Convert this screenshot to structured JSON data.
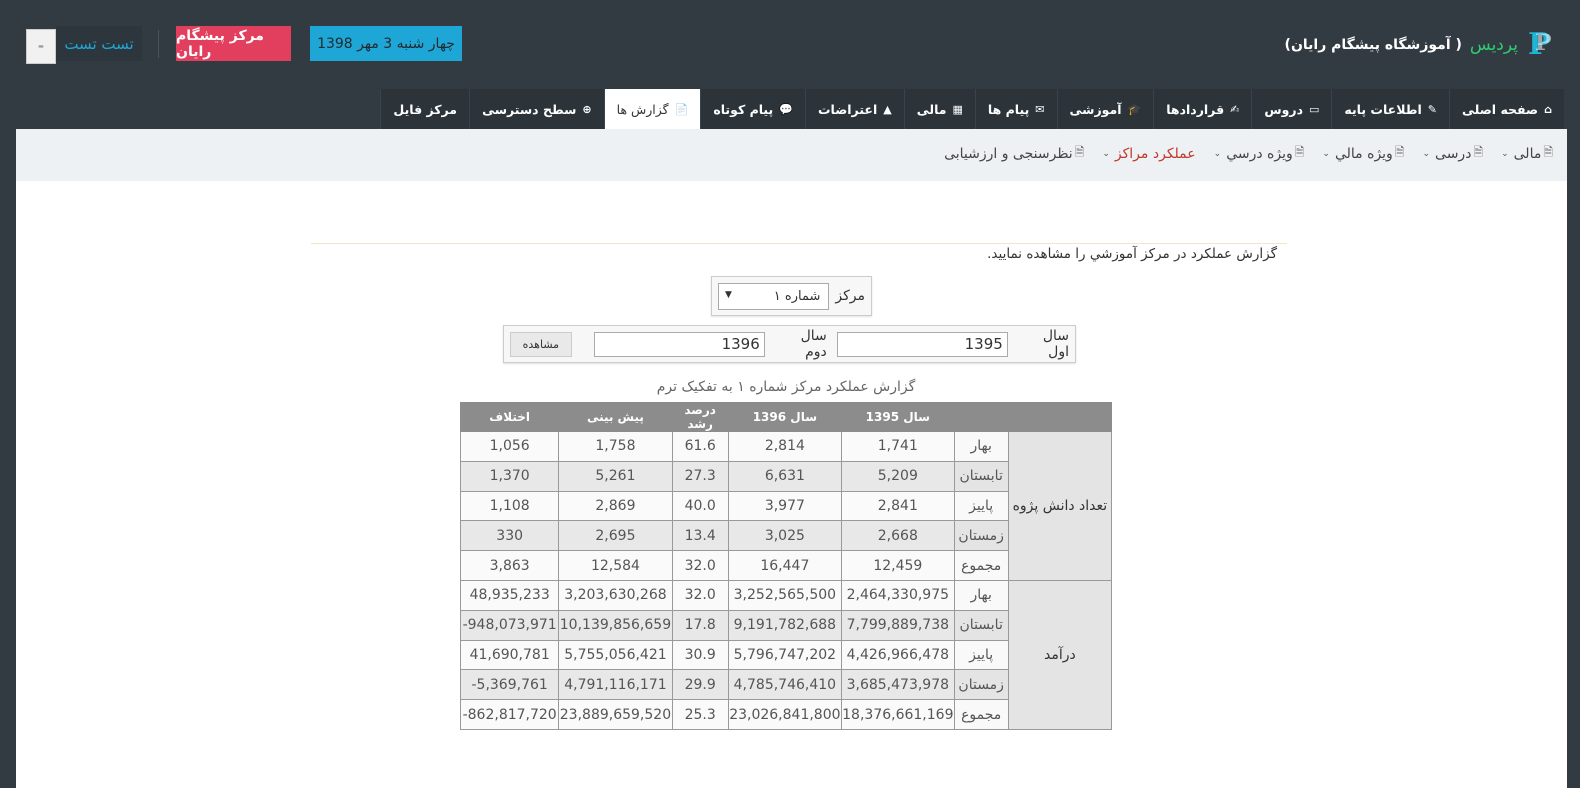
{
  "header": {
    "brand_name": "پردیس",
    "brand_sub": "( آموزشگاه پیشگام رایان)",
    "date": "چهار شنبه 3 مهر 1398",
    "center": "مرکز پیشگام رایان",
    "user": "تست تست"
  },
  "mainnav": [
    {
      "label": "صفحه اصلی",
      "icon": "⌂"
    },
    {
      "label": "اطلاعات پایه",
      "icon": "✎"
    },
    {
      "label": "دروس",
      "icon": "▭"
    },
    {
      "label": "قراردادها",
      "icon": "✍"
    },
    {
      "label": "آموزشی",
      "icon": "🎓"
    },
    {
      "label": "پیام ها",
      "icon": "✉"
    },
    {
      "label": "مالی",
      "icon": "▦"
    },
    {
      "label": "اعتراضات",
      "icon": "▲"
    },
    {
      "label": "پیام کوتاه",
      "icon": "💬"
    },
    {
      "label": "گزارش ها",
      "icon": "📄"
    },
    {
      "label": "سطح دسترسی",
      "icon": "⊕"
    },
    {
      "label": "مرکز فایل",
      "icon": ""
    }
  ],
  "subnav": [
    "مالی",
    "درسی",
    "ويژه مالي",
    "ويژه درسي",
    "عملکرد مراکز",
    "نظرسنجی و ارزشیابی"
  ],
  "intro": "گزارش عملکرد در مرکز آموزشي را مشاهده نماييد.",
  "form": {
    "center_label": "مرکز",
    "center_value": "شماره ۱",
    "year1_label": "سال اول",
    "year1_value": "1395",
    "year2_label": "سال دوم",
    "year2_value": "1396",
    "view_label": "مشاهده"
  },
  "report": {
    "caption": "گزارش عملکرد مرکز شماره ۱ به تفکیک ترم",
    "headers": [
      "",
      "",
      "سال 1395",
      "سال 1396",
      "درصد رشد",
      "پیش بینی",
      "اختلاف"
    ],
    "groups": [
      {
        "name": "تعداد دانش پژوه",
        "rows": [
          [
            "بهار",
            "1,741",
            "2,814",
            "61.6",
            "1,758",
            "1,056"
          ],
          [
            "تابستان",
            "5,209",
            "6,631",
            "27.3",
            "5,261",
            "1,370"
          ],
          [
            "پاییز",
            "2,841",
            "3,977",
            "40.0",
            "2,869",
            "1,108"
          ],
          [
            "زمستان",
            "2,668",
            "3,025",
            "13.4",
            "2,695",
            "330"
          ],
          [
            "مجموع",
            "12,459",
            "16,447",
            "32.0",
            "12,584",
            "3,863"
          ]
        ]
      },
      {
        "name": "درآمد",
        "rows": [
          [
            "بهار",
            "2,464,330,975",
            "3,252,565,500",
            "32.0",
            "3,203,630,268",
            "48,935,233"
          ],
          [
            "تابستان",
            "7,799,889,738",
            "9,191,782,688",
            "17.8",
            "10,139,856,659",
            "948,073,971-"
          ],
          [
            "پاییز",
            "4,426,966,478",
            "5,796,747,202",
            "30.9",
            "5,755,056,421",
            "41,690,781"
          ],
          [
            "زمستان",
            "3,685,473,978",
            "4,785,746,410",
            "29.9",
            "4,791,116,171",
            "5,369,761-"
          ],
          [
            "مجموع",
            "18,376,661,169",
            "23,026,841,800",
            "25.3",
            "23,889,659,520",
            "862,817,720-"
          ]
        ]
      }
    ]
  }
}
